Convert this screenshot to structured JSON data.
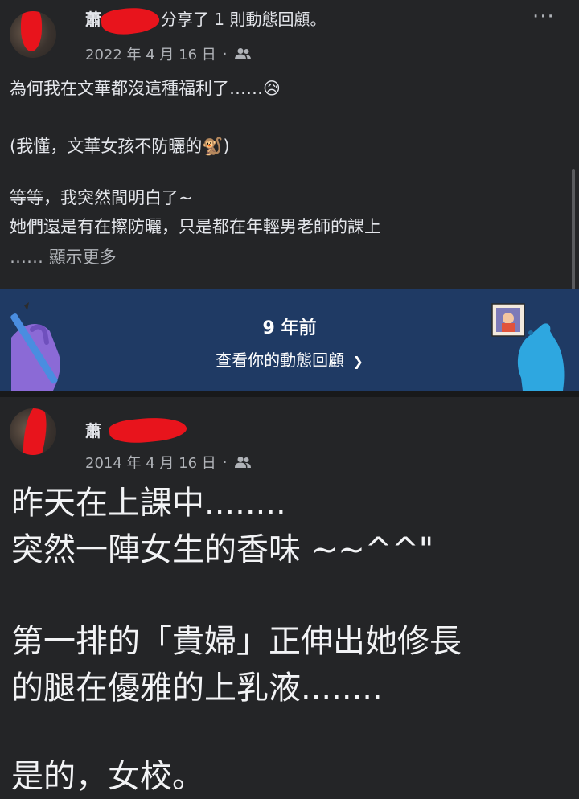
{
  "post1": {
    "author": "蕭",
    "action": "分享了 1 則動態回顧。",
    "date": "2022 年 4 月 16 日",
    "separator": "·",
    "more_label": "···",
    "lines": [
      "為何我在文華都沒這種福利了……😥",
      "(我懂，文華女孩不防曬的🐒)",
      "等等，我突然間明白了~",
      "她們還是有在擦防曬，只是都在年輕男老師的課上"
    ],
    "ellipsis": "…… ",
    "see_more": "顯示更多"
  },
  "memory_banner": {
    "title": "9 年前",
    "link": "查看你的動態回顧",
    "link_chevron": "❯",
    "background": "#1f3a64"
  },
  "post2": {
    "author": "蕭",
    "date": "2014 年 4 月 16 日",
    "separator": "·",
    "lines": [
      "昨天在上課中........",
      "突然一陣女生的香味 ~~^^\"",
      "第一排的「貴婦」正伸出她修長",
      "的腿在優雅的上乳液........",
      "是的，女校。"
    ]
  },
  "colors": {
    "background": "#242527",
    "redaction": "#e8141c",
    "muted_text": "#b0b3b8"
  }
}
